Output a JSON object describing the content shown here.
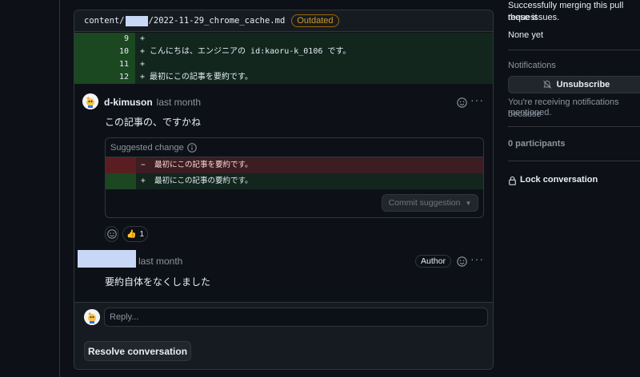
{
  "file": {
    "path_prefix": "content/",
    "path_suffix": "/2022-11-29_chrome_cache.md",
    "status_badge": "Outdated"
  },
  "diff": {
    "lines": [
      {
        "num": "9",
        "text": "+"
      },
      {
        "num": "10",
        "text": "+ こんにちは、エンジニアの id:kaoru-k_0106 です。"
      },
      {
        "num": "11",
        "text": "+"
      },
      {
        "num": "12",
        "text": "+ 最初にこの記事を要約です。"
      }
    ]
  },
  "comment1": {
    "author": "d-kimuson",
    "time": "last month",
    "body": "この記事の、ですかね",
    "suggested_label": "Suggested change",
    "suggestion_del": "−  最初にこの記事を要約です。",
    "suggestion_add": "+  最初にこの記事の要約です。",
    "commit_label": "Commit suggestion",
    "reaction_emoji": "👍",
    "reaction_count": "1"
  },
  "comment2": {
    "time": "last month",
    "badge": "Author",
    "body": "要約自体をなくしました"
  },
  "reply": {
    "placeholder": "Reply..."
  },
  "resolve_label": "Resolve conversation",
  "sidebar": {
    "merge_text_1": "Successfully merging this pull request",
    "merge_text_2": "these issues.",
    "none_yet": "None yet",
    "notifications_heading": "Notifications",
    "unsubscribe_label": "Unsubscribe",
    "notify_text_1": "You're receiving notifications because",
    "notify_text_2": "mentioned.",
    "participants": "0 participants",
    "lock_label": "Lock conversation"
  },
  "colors": {
    "accent_outdated": "#d29922",
    "diff_add": "#12261e",
    "diff_del": "#3b1d22"
  }
}
